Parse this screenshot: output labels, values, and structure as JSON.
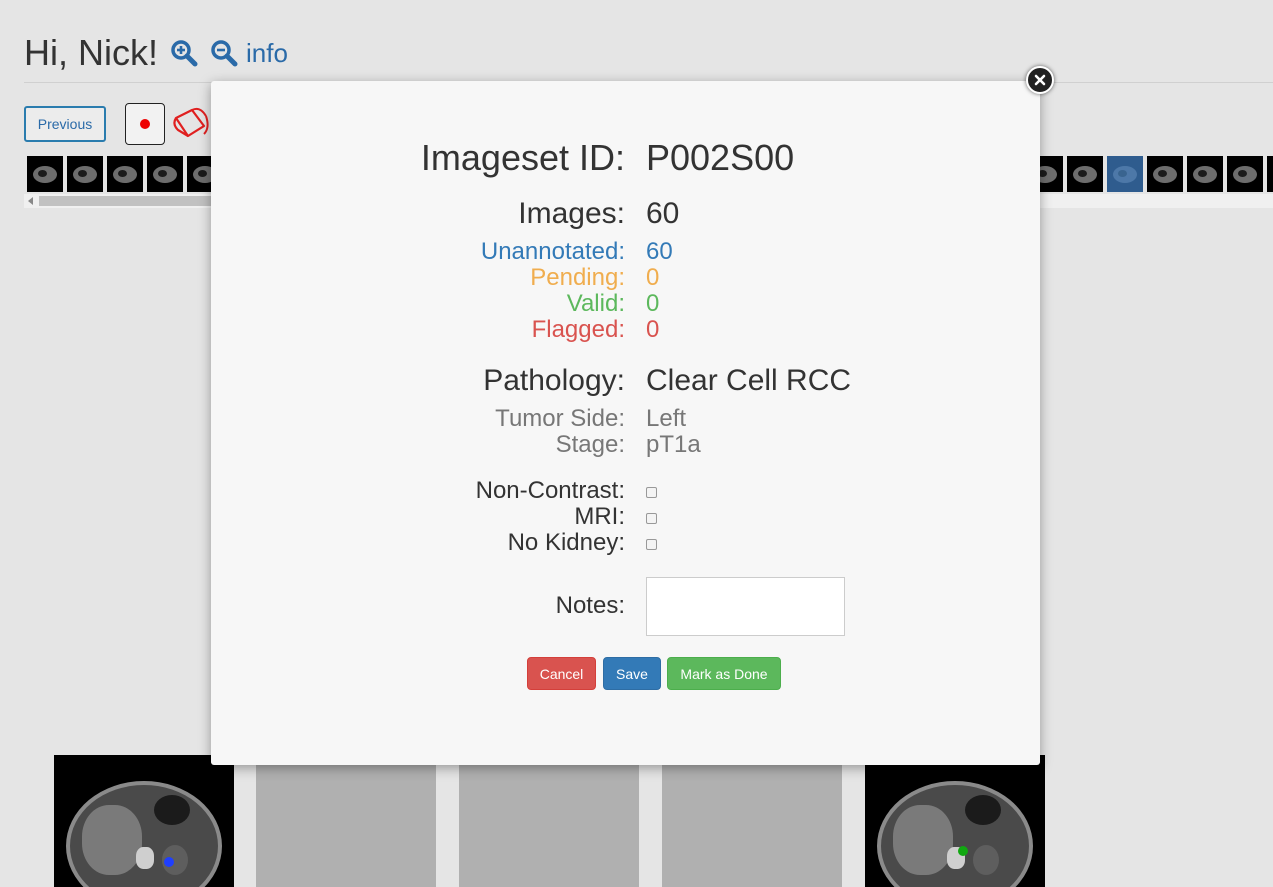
{
  "header": {
    "greeting": "Hi, Nick!",
    "zoom_in_icon": "zoom-in-icon",
    "zoom_out_icon": "zoom-out-icon",
    "info_link": "info"
  },
  "toolbar": {
    "previous_label": "Previous",
    "record_icon": "record-icon",
    "paint_bucket_icon": "paint-bucket-icon"
  },
  "modal": {
    "imageset_label": "Imageset ID:",
    "imageset_value": "P002S00",
    "images_label": "Images:",
    "images_value": "60",
    "unannotated_label": "Unannotated:",
    "unannotated_value": "60",
    "pending_label": "Pending:",
    "pending_value": "0",
    "valid_label": "Valid:",
    "valid_value": "0",
    "flagged_label": "Flagged:",
    "flagged_value": "0",
    "pathology_label": "Pathology:",
    "pathology_value": "Clear Cell RCC",
    "tumor_side_label": "Tumor Side:",
    "tumor_side_value": "Left",
    "stage_label": "Stage:",
    "stage_value": "pT1a",
    "non_contrast_label": "Non-Contrast:",
    "non_contrast_checked": false,
    "mri_label": "MRI:",
    "mri_checked": false,
    "no_kidney_label": "No Kidney:",
    "no_kidney_checked": false,
    "notes_label": "Notes:",
    "notes_value": "",
    "cancel_label": "Cancel",
    "save_label": "Save",
    "done_label": "Mark as Done",
    "close_icon": "close-icon"
  },
  "colors": {
    "unannotated": "#337ab7",
    "pending": "#f0ad4e",
    "valid": "#5cb85c",
    "flagged": "#d9534f",
    "annotation_blue": "#1f3fff",
    "annotation_green": "#11a811"
  }
}
